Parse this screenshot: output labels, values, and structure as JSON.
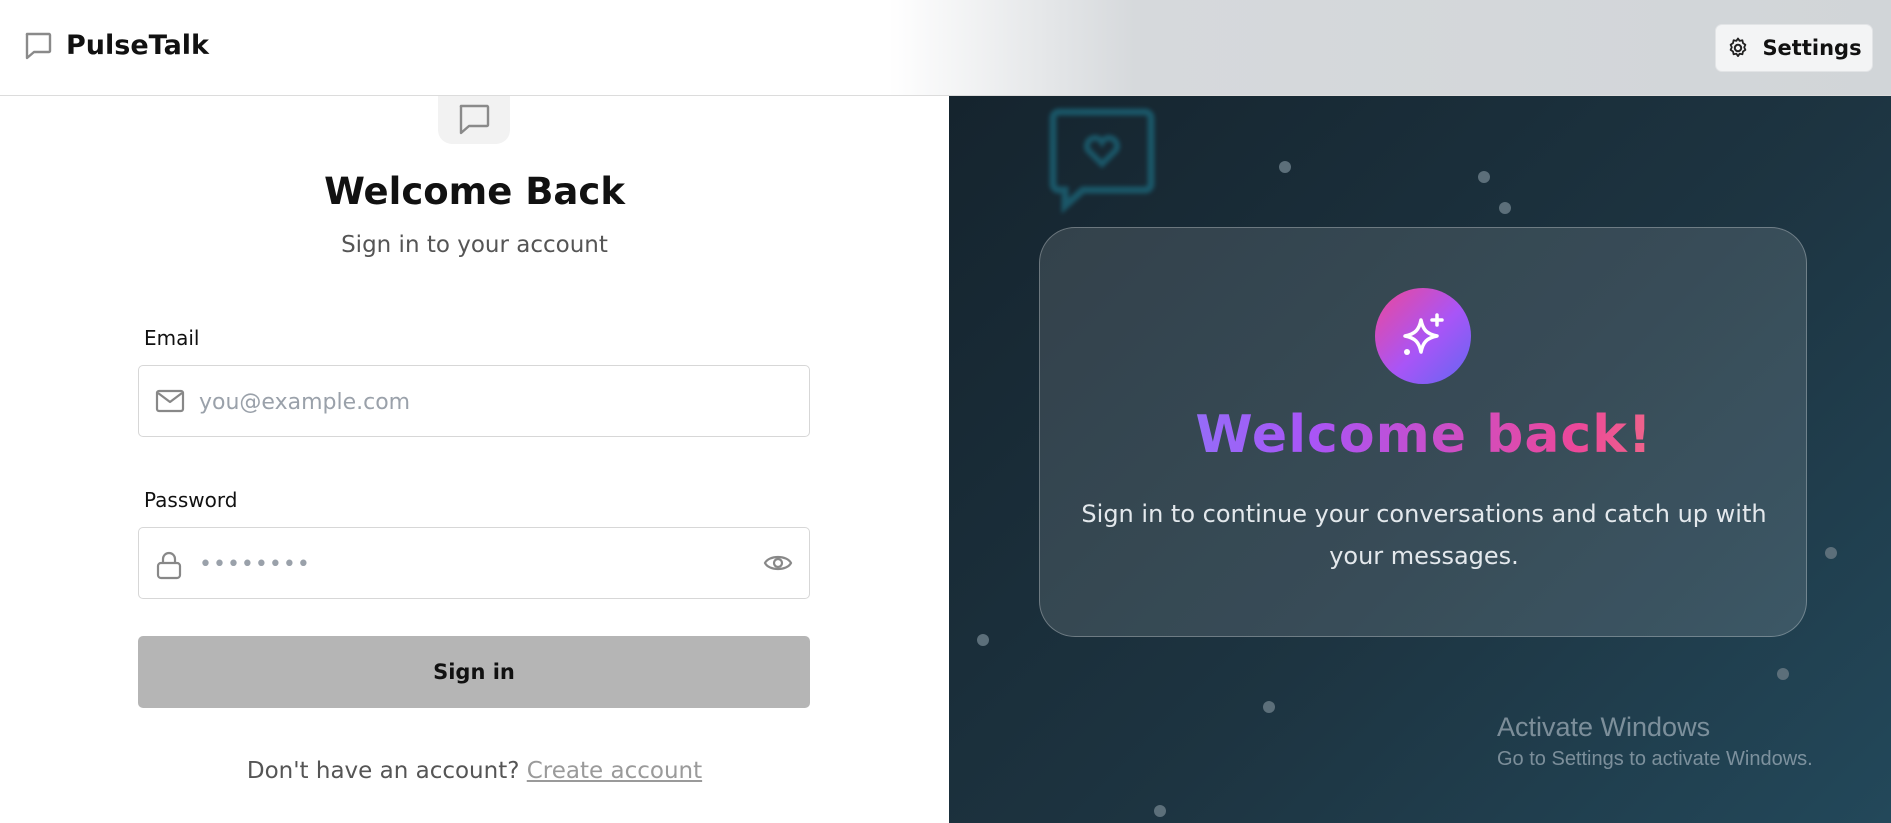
{
  "header": {
    "app_name": "PulseTalk",
    "settings_label": "Settings"
  },
  "form": {
    "title": "Welcome Back",
    "subtitle": "Sign in to your account",
    "email_label": "Email",
    "email_placeholder": "you@example.com",
    "password_label": "Password",
    "password_value": "••••••••",
    "submit_label": "Sign in",
    "signup_prompt": "Don't have an account?",
    "signup_link": "Create account"
  },
  "promo": {
    "title": "Welcome back!",
    "text": "Sign in to continue your conversations and catch up with your messages."
  },
  "system_overlay": {
    "title": "Activate Windows",
    "subtitle": "Go to Settings to activate Windows."
  },
  "colors": {
    "accent_gradient": [
      "#ec4899",
      "#a855f7",
      "#6366f1"
    ],
    "button_disabled": "#b5b5b5",
    "panel_bg": "#1d3441"
  },
  "icons": [
    "chat-bubble-icon",
    "gear-icon",
    "mail-icon",
    "lock-icon",
    "eye-icon",
    "sparkles-icon",
    "heart-chat-icon"
  ]
}
